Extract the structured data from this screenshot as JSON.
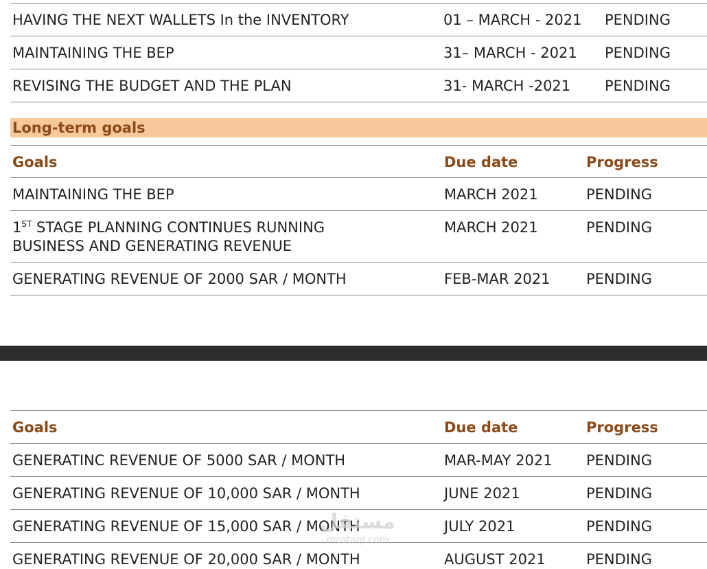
{
  "short_term_rows": [
    {
      "goal": "HAVING THE NEXT WALLETS In the INVENTORY",
      "due": "01 – MARCH - 2021",
      "progress": "PENDING"
    },
    {
      "goal": "MAINTAINING THE BEP",
      "due": "31– MARCH - 2021",
      "progress": "PENDING"
    },
    {
      "goal": "REVISING THE BUDGET AND THE PLAN",
      "due": "31- MARCH -2021",
      "progress": "PENDING"
    }
  ],
  "long_term": {
    "title": "Long-term goals",
    "headers": {
      "goals": "Goals",
      "due_date": "Due date",
      "progress": "Progress"
    },
    "rows": [
      {
        "goal": "MAINTAINING THE BEP",
        "due": "MARCH 2021",
        "progress": "PENDING"
      },
      {
        "goal_num": "1",
        "goal_sup": "ST",
        "goal_line1": " STAGE PLANNING CONTINUES RUNNING",
        "goal_line2": "BUSINESS AND GENERATING REVENUE",
        "due": "MARCH  2021",
        "progress": "PENDING"
      },
      {
        "goal": "GENERATING REVENUE OF 2000 SAR / MONTH",
        "due": "FEB-MAR 2021",
        "progress": "PENDING"
      }
    ]
  },
  "continued": {
    "headers": {
      "goals": "Goals",
      "due_date": "Due date",
      "progress": "Progress"
    },
    "rows": [
      {
        "goal": "GENERATINC REVENUE OF 5000 SAR / MONTH",
        "due": "MAR-MAY 2021",
        "progress": "PENDING"
      },
      {
        "goal": "GENERATING REVENUE OF 10,000 SAR / MONTH",
        "due": "JUNE 2021",
        "progress": "PENDING"
      },
      {
        "goal": "GENERATING REVENUE OF 15,000 SAR / MONTH",
        "due": "JULY 2021",
        "progress": "PENDING"
      },
      {
        "goal": "GENERATING REVENUE OF 20,000 SAR / MONTH",
        "due": "AUGUST 2021",
        "progress": "PENDING"
      }
    ]
  },
  "watermark": {
    "arabic": "مستقل",
    "latin": "mostaql.com"
  }
}
